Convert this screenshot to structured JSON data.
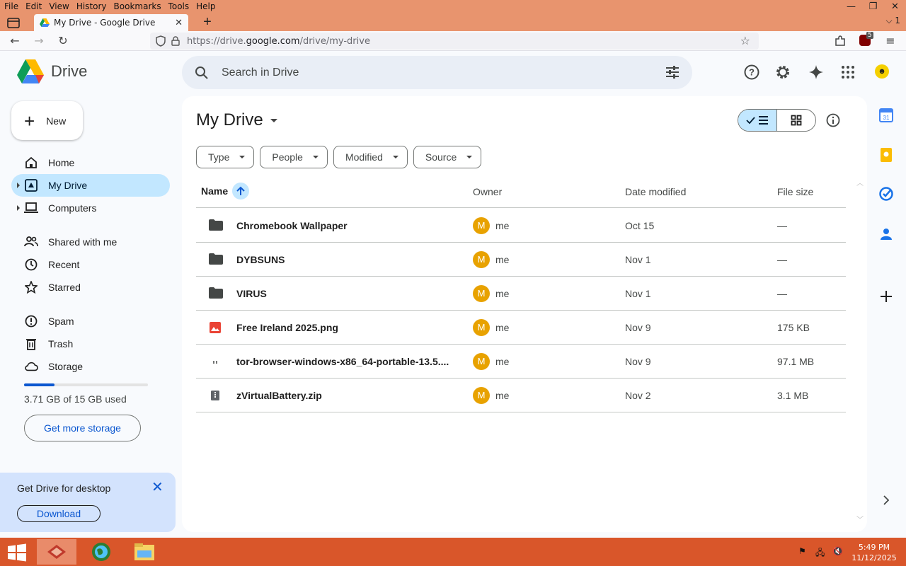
{
  "browser": {
    "menu": [
      "File",
      "Edit",
      "View",
      "History",
      "Bookmarks",
      "Tools",
      "Help"
    ],
    "tab_title": "My Drive - Google Drive",
    "tab_close": "✕",
    "new_tab": "+",
    "tab_overflow": "⌵ 1",
    "url_prefix": "https://drive.",
    "url_domain": "google.com",
    "url_path": "/drive/my-drive",
    "badge_count": "5",
    "window_controls": [
      "—",
      "❐",
      "✕"
    ]
  },
  "header": {
    "logo_text": "Drive",
    "search_placeholder": "Search in Drive"
  },
  "sidebar": {
    "new_label": "New",
    "items": [
      {
        "label": "Home"
      },
      {
        "label": "My Drive"
      },
      {
        "label": "Computers"
      },
      {
        "label": "Shared with me"
      },
      {
        "label": "Recent"
      },
      {
        "label": "Starred"
      },
      {
        "label": "Spam"
      },
      {
        "label": "Trash"
      },
      {
        "label": "Storage"
      }
    ],
    "storage_fraction": 0.247,
    "storage_text": "3.71 GB of 15 GB used",
    "get_more_storage": "Get more storage",
    "promo_text": "Get Drive for desktop",
    "promo_download": "Download"
  },
  "main": {
    "title": "My Drive",
    "filters": [
      "Type",
      "People",
      "Modified",
      "Source"
    ],
    "columns": {
      "name": "Name",
      "owner": "Owner",
      "date": "Date modified",
      "size": "File size"
    },
    "files": [
      {
        "name": "Chromebook Wallpaper",
        "type": "folder",
        "owner_initial": "M",
        "owner": "me",
        "date": "Oct 15",
        "size": "—"
      },
      {
        "name": "DYBSUNS",
        "type": "folder",
        "owner_initial": "M",
        "owner": "me",
        "date": "Nov 1",
        "size": "—"
      },
      {
        "name": "VIRUS",
        "type": "folder",
        "owner_initial": "M",
        "owner": "me",
        "date": "Nov 1",
        "size": "—"
      },
      {
        "name": "Free Ireland 2025.png",
        "type": "image",
        "owner_initial": "M",
        "owner": "me",
        "date": "Nov 9",
        "size": "175 KB"
      },
      {
        "name": "tor-browser-windows-x86_64-portable-13.5....",
        "type": "binary",
        "owner_initial": "M",
        "owner": "me",
        "date": "Nov 9",
        "size": "97.1 MB"
      },
      {
        "name": "zVirtualBattery.zip",
        "type": "zip",
        "owner_initial": "M",
        "owner": "me",
        "date": "Nov 2",
        "size": "3.1 MB"
      }
    ]
  },
  "taskbar": {
    "time": "5:49 PM",
    "date": "11/12/2025"
  },
  "colors": {
    "accent": "#0b57d0",
    "selected": "#c2e7ff",
    "avatar": "#e8a200",
    "titlebar": "#e8946e",
    "taskbar": "#d9562a"
  }
}
